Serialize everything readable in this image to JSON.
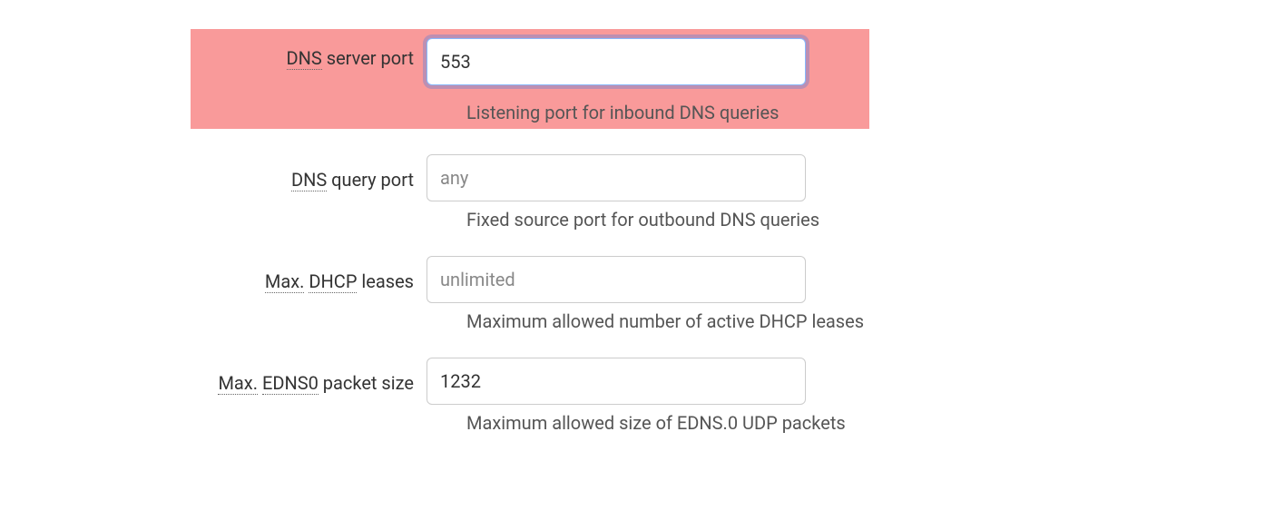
{
  "fields": {
    "dns_server_port": {
      "label_prefix_abbr": "DNS",
      "label_suffix": " server port",
      "value": "553",
      "placeholder": "",
      "help": "Listening port for inbound DNS queries"
    },
    "dns_query_port": {
      "label_prefix_abbr": "DNS",
      "label_suffix": " query port",
      "value": "",
      "placeholder": "any",
      "help": "Fixed source port for outbound DNS queries"
    },
    "max_dhcp_leases": {
      "label_abbr1": "Max.",
      "label_abbr2": "DHCP",
      "label_suffix": " leases",
      "value": "",
      "placeholder": "unlimited",
      "help": "Maximum allowed number of active DHCP leases"
    },
    "max_edns0_size": {
      "label_abbr1": "Max.",
      "label_abbr2": "EDNS0",
      "label_suffix": " packet size",
      "value": "1232",
      "placeholder": "",
      "help": "Maximum allowed size of EDNS.0 UDP packets"
    }
  }
}
